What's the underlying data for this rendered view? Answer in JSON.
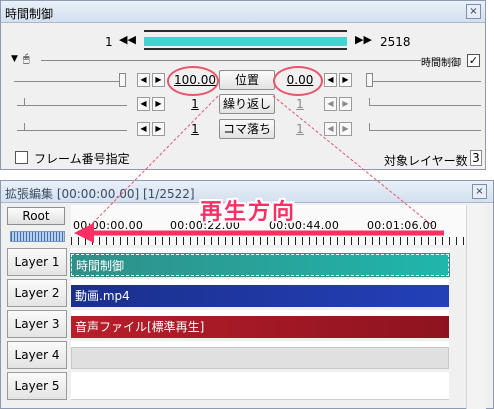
{
  "top_window": {
    "title": "時間制御",
    "close_glyph": "×",
    "seek": {
      "start": "1",
      "end": "2518",
      "progress": 1.0
    },
    "header_label": "時間制御",
    "header_checked": "✓",
    "rows": [
      {
        "left_value": "100.00",
        "button": "位置",
        "right_value": "0.00"
      },
      {
        "left_value": "1",
        "button": "繰り返し",
        "right_value": "1"
      },
      {
        "left_value": "1",
        "button": "コマ落ち",
        "right_value": "1"
      }
    ],
    "frame_checkbox_label": "フレーム番号指定",
    "target_layers_label": "対象レイヤー数",
    "target_layers_value": "3"
  },
  "timeline": {
    "title": "拡張編集 [00:00:00.00] [1/2522]",
    "close_glyph": "×",
    "root_label": "Root",
    "time_marks": [
      "00:00:00.00",
      "00:00:22.00",
      "00:00:44.00",
      "00:01:06.00"
    ],
    "direction_label": "再生方向",
    "layers": [
      {
        "label": "Layer 1",
        "clip": "時間制御",
        "color_from": "#2f8f88",
        "color_to": "#20b6ac"
      },
      {
        "label": "Layer 2",
        "clip": "動画.mp4",
        "color_from": "#1a2f8c",
        "color_to": "#2340b8"
      },
      {
        "label": "Layer 3",
        "clip": "音声ファイル[標準再生]",
        "color_from": "#b81e2a",
        "color_to": "#8e1320"
      },
      {
        "label": "Layer 4",
        "clip": ""
      },
      {
        "label": "Layer 5",
        "clip": ""
      }
    ]
  },
  "annotation_color": "#e8566a"
}
